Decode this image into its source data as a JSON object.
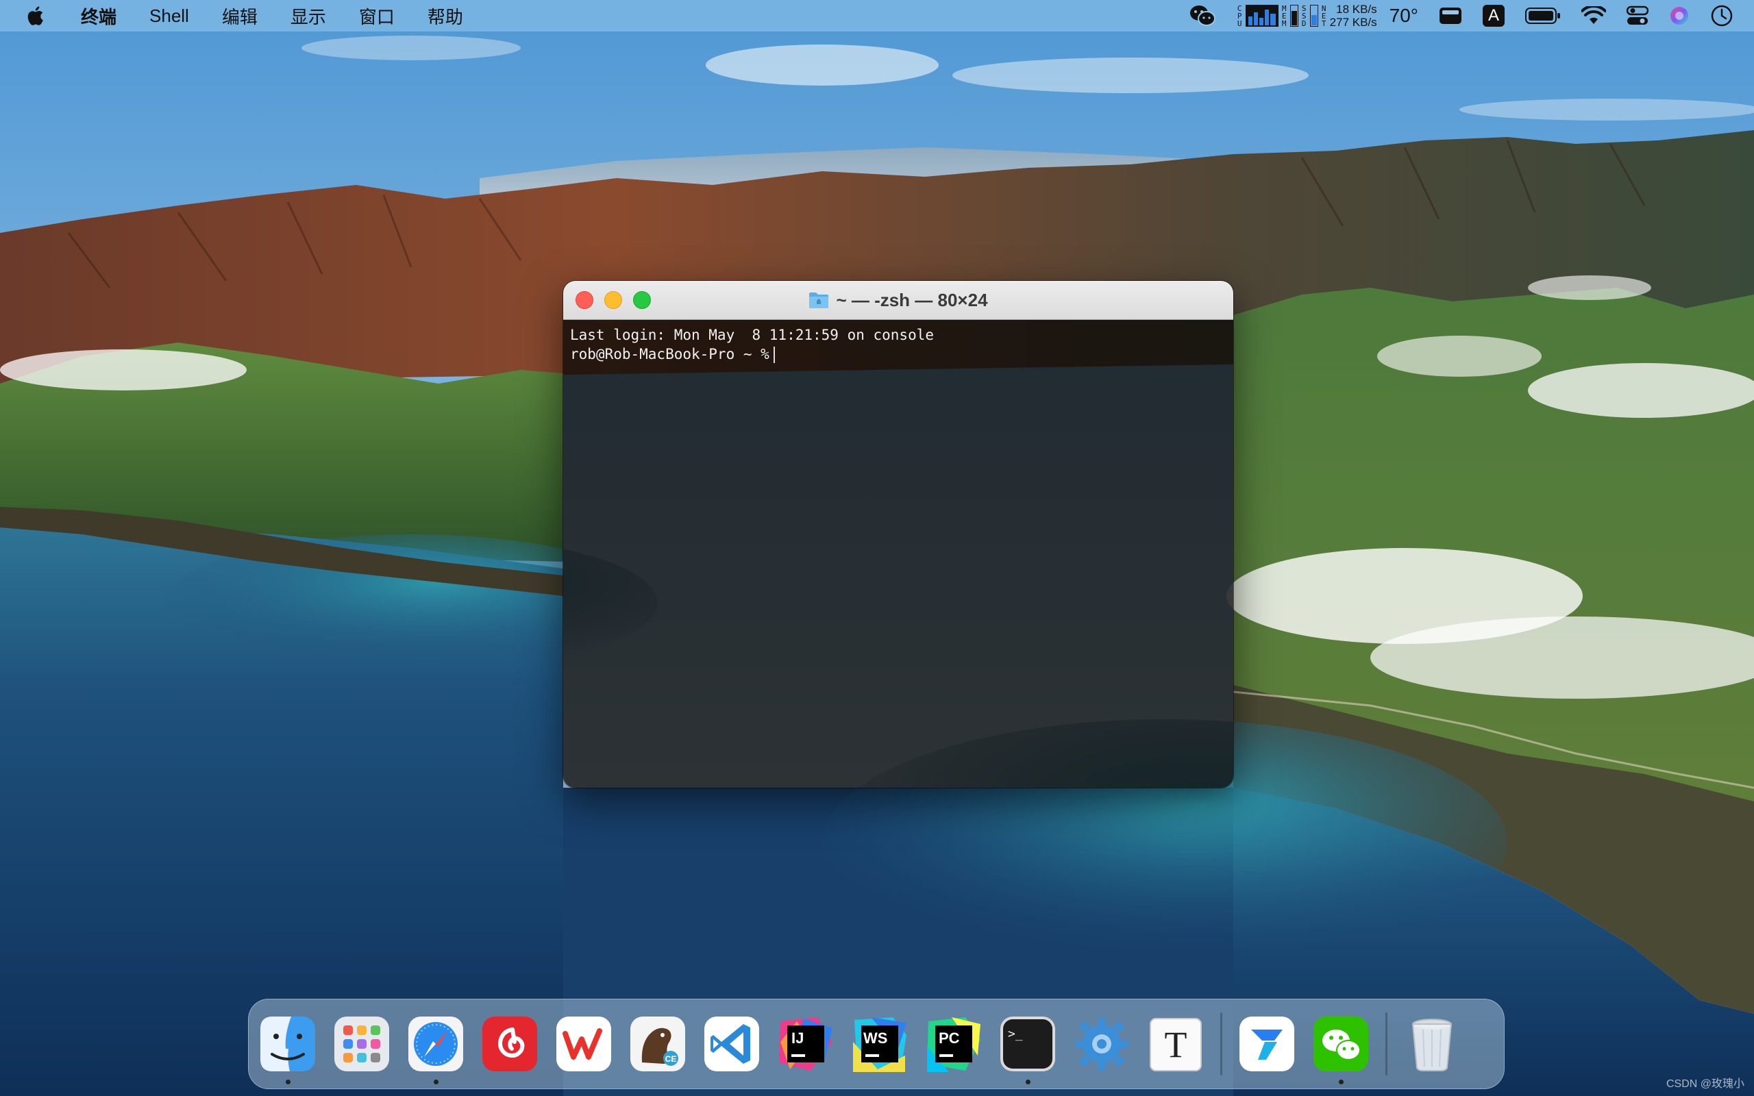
{
  "menubar": {
    "app_name": "终端",
    "items": [
      "Shell",
      "编辑",
      "显示",
      "窗口",
      "帮助"
    ],
    "cpu_label": "CPU",
    "mem_label": "MEM",
    "ssd_label": "SSD",
    "net_label": "NET",
    "net_up": "18 KB/s",
    "net_down": "277 KB/s",
    "temperature": "70°",
    "input_method": "A"
  },
  "terminal": {
    "title": "~ — -zsh — 80×24",
    "lines": [
      "Last login: Mon May  8 11:21:59 on console",
      "rob@Rob-MacBook-Pro ~ %"
    ]
  },
  "dock": {
    "apps": [
      {
        "name": "finder",
        "running": true
      },
      {
        "name": "launchpad",
        "running": false
      },
      {
        "name": "safari",
        "running": true
      },
      {
        "name": "netease-music",
        "running": false
      },
      {
        "name": "wps",
        "running": false
      },
      {
        "name": "sequel-ace",
        "running": false
      },
      {
        "name": "vscode",
        "running": false
      },
      {
        "name": "intellij",
        "running": false
      },
      {
        "name": "webstorm",
        "running": false
      },
      {
        "name": "pycharm",
        "running": false
      },
      {
        "name": "terminal",
        "running": true
      },
      {
        "name": "system-settings",
        "running": false
      },
      {
        "name": "typora",
        "running": false
      },
      {
        "name": "lanxin",
        "running": false
      },
      {
        "name": "wechat",
        "running": true
      },
      {
        "name": "trash",
        "running": false
      }
    ],
    "label_ij": "IJ",
    "label_ws": "WS",
    "label_pc": "PC",
    "label_ce": "CE",
    "label_t": "T",
    "label_prompt": ">_"
  },
  "watermark": "CSDN @玫瑰小",
  "colors": {
    "sky_top": "#5aa0d8",
    "sea": "#1d4a78",
    "accent_close": "#ff5f57",
    "accent_min": "#febc2e",
    "accent_max": "#28c840"
  }
}
